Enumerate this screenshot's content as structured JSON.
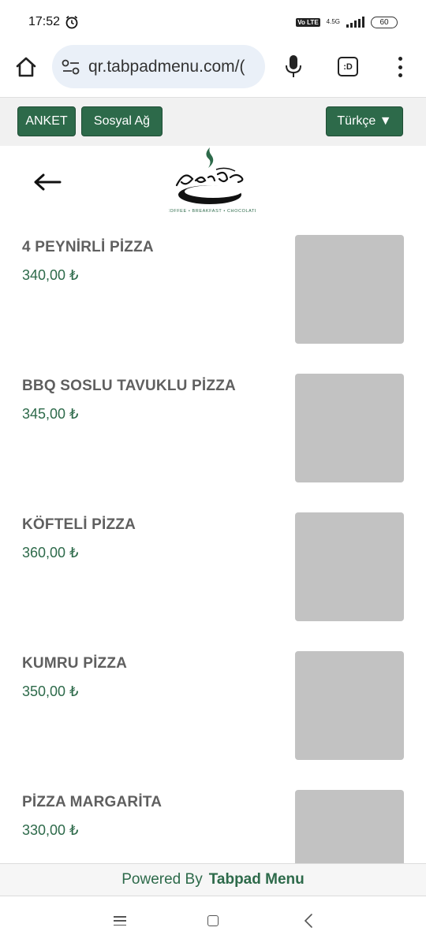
{
  "status_bar": {
    "time": "17:52",
    "network": "4.5G",
    "volte": "Vo LTE",
    "battery": "60"
  },
  "browser": {
    "url": "qr.tabpadmenu.com/(",
    "tab_label": ":D"
  },
  "actions": {
    "survey_label": "ANKET",
    "social_label": "Sosyal Ağ",
    "language_label": "Türkçe ▼"
  },
  "header": {
    "logo_icon": "sancar-bey-logo"
  },
  "menu_items": [
    {
      "name": "4 PEYNİRLİ PİZZA",
      "price": "340,00 ₺"
    },
    {
      "name": "BBQ SOSLU TAVUKLU PİZZA",
      "price": "345,00 ₺"
    },
    {
      "name": "KÖFTELİ PİZZA",
      "price": "360,00 ₺"
    },
    {
      "name": "KUMRU PİZZA",
      "price": "350,00 ₺"
    },
    {
      "name": "PİZZA MARGARİTA",
      "price": "330,00 ₺"
    }
  ],
  "footer": {
    "powered_by": "Powered By",
    "brand": "Tabpad Menu"
  },
  "colors": {
    "accent": "#2d6a4a",
    "placeholder": "#c2c2c2"
  }
}
